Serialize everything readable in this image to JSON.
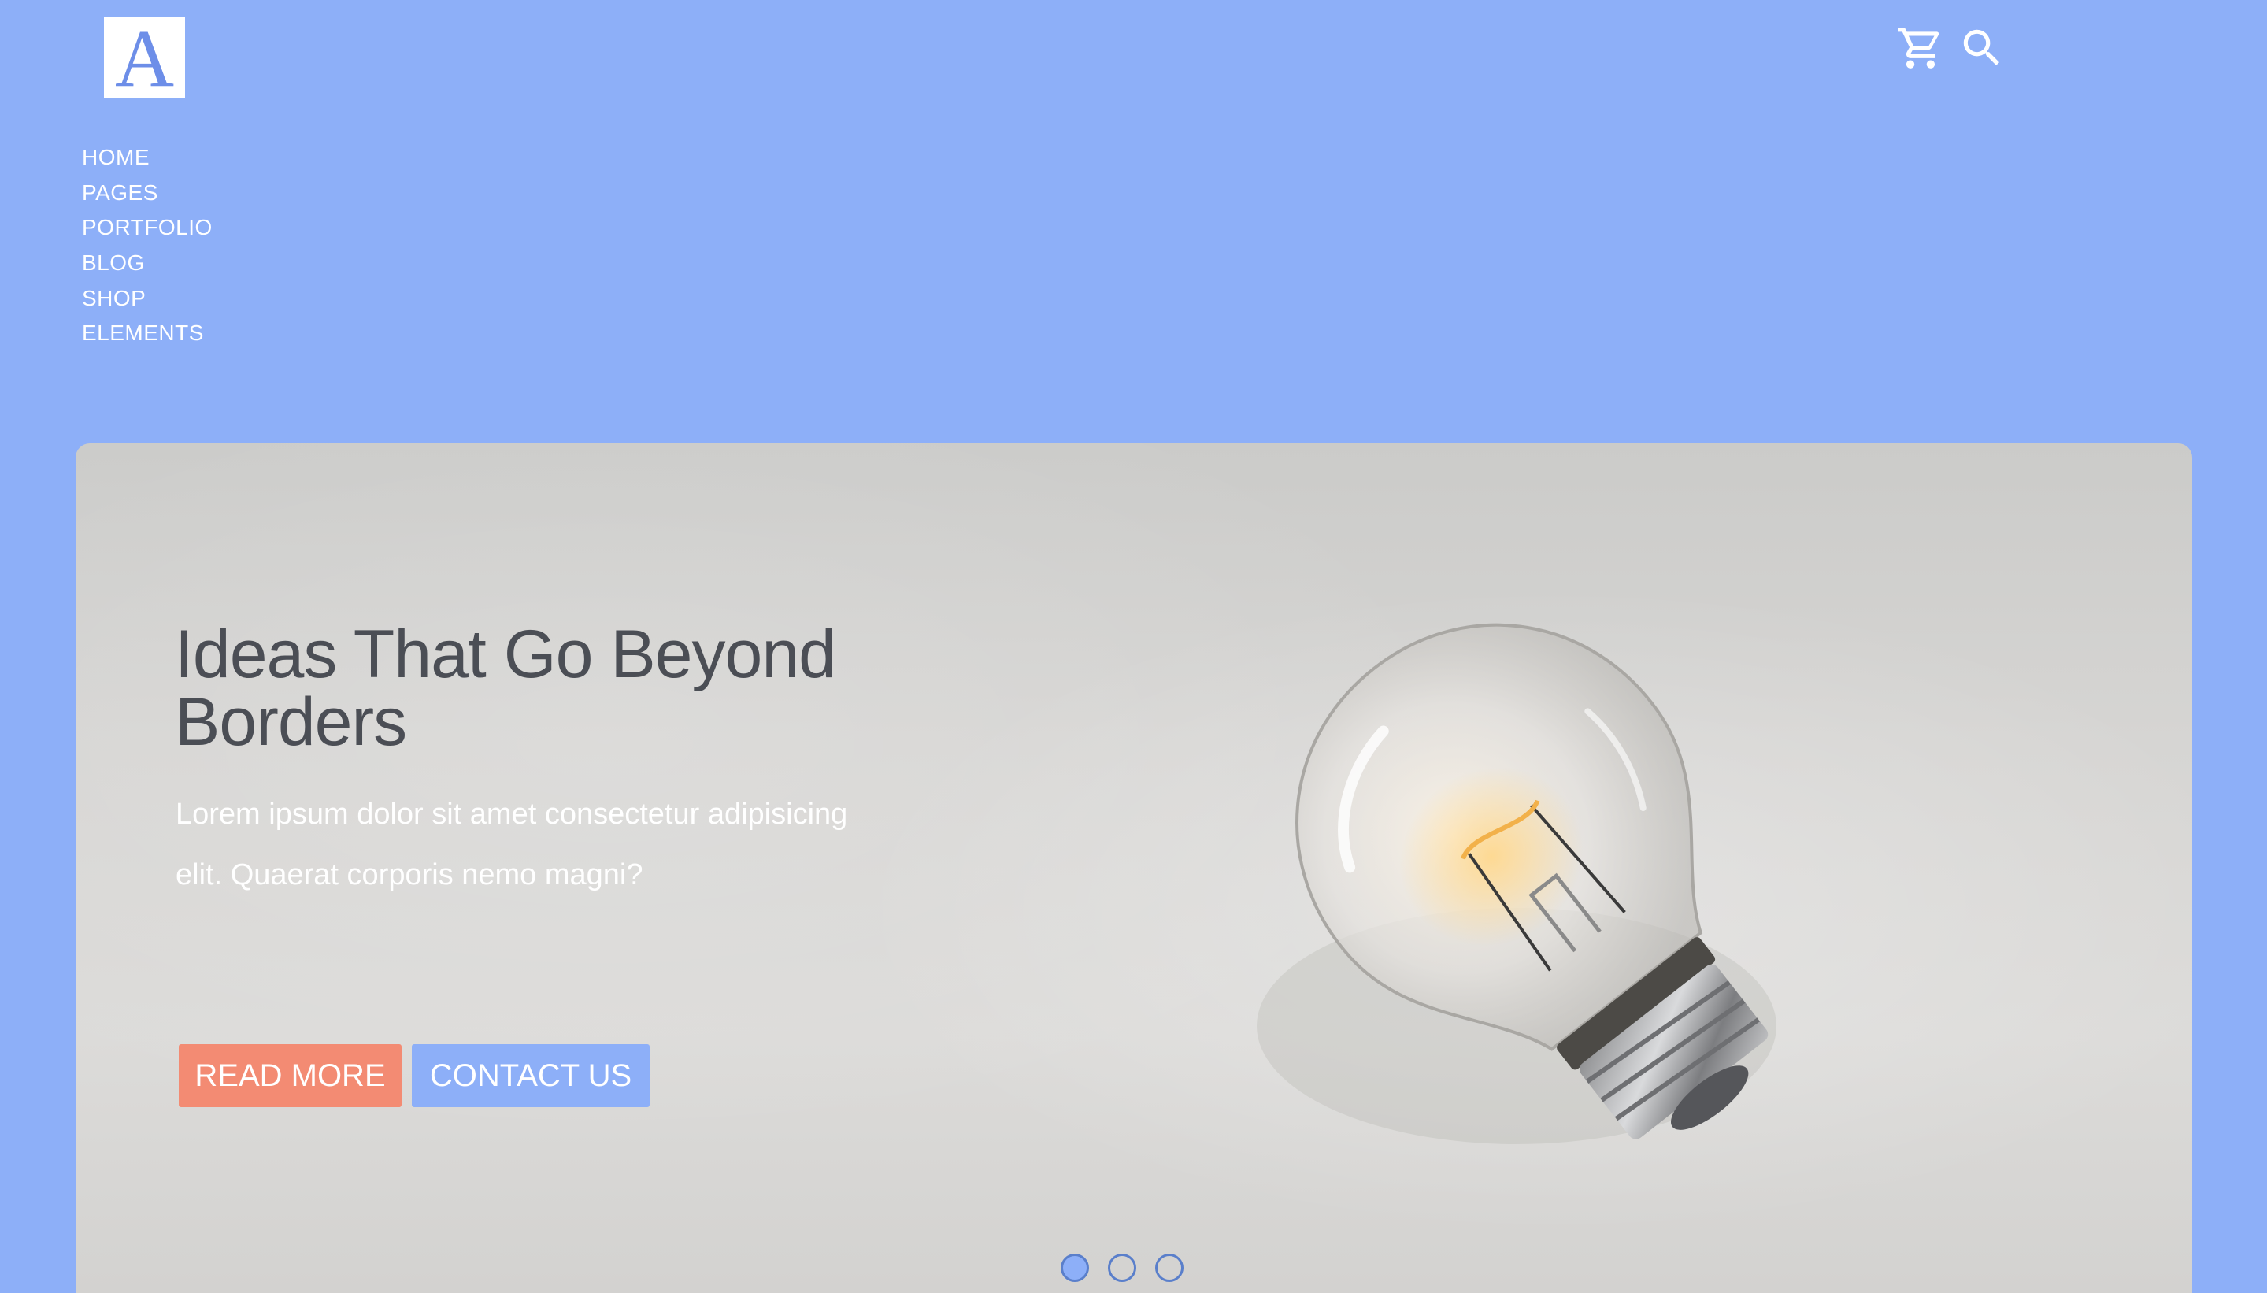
{
  "logo": {
    "letter": "A"
  },
  "header": {
    "icons": [
      "cart-icon",
      "search-icon"
    ]
  },
  "nav": {
    "items": [
      {
        "label": "HOME"
      },
      {
        "label": "PAGES"
      },
      {
        "label": "PORTFOLIO"
      },
      {
        "label": "BLOG"
      },
      {
        "label": "SHOP"
      },
      {
        "label": "ELEMENTS"
      }
    ]
  },
  "hero": {
    "title": "Ideas That Go Beyond Borders",
    "text": "Lorem ipsum dolor sit amet consectetur adipisicing elit. Quaerat corporis nemo magni?",
    "read_more_label": "READ MORE",
    "contact_label": "CONTACT US",
    "slides_count": 3,
    "active_slide": 1
  },
  "colors": {
    "background": "#8daff8",
    "accent_coral": "#f38b73",
    "accent_blue": "#8daff8",
    "title_text": "#4b4e55"
  }
}
